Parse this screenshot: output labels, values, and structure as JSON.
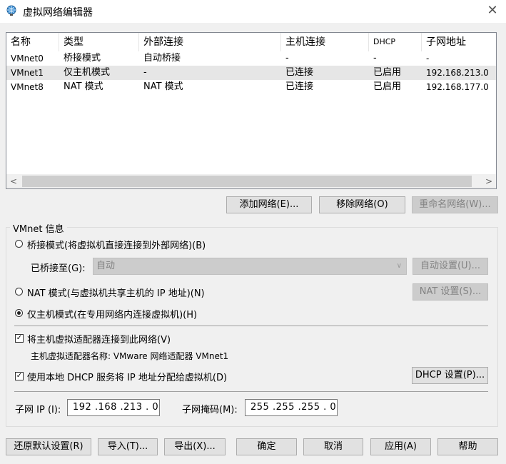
{
  "window": {
    "title": "虚拟网络编辑器",
    "close": "✕"
  },
  "table": {
    "headers": [
      "名称",
      "类型",
      "外部连接",
      "主机连接",
      "DHCP",
      "子网地址"
    ],
    "rows": [
      [
        "VMnet0",
        "桥接模式",
        "自动桥接",
        "-",
        "-",
        "-"
      ],
      [
        "VMnet1",
        "仅主机模式",
        "-",
        "已连接",
        "已启用",
        "192.168.213.0"
      ],
      [
        "VMnet8",
        "NAT 模式",
        "NAT 模式",
        "已连接",
        "已启用",
        "192.168.177.0"
      ]
    ],
    "scroll_left": "<",
    "scroll_right": ">"
  },
  "list_buttons": {
    "add": "添加网络(E)...",
    "remove": "移除网络(O)",
    "rename": "重命名网络(W)..."
  },
  "vmnet_info": {
    "label": "VMnet 信息",
    "bridged": "桥接模式(将虚拟机直接连接到外部网络)(B)",
    "bridged_to_label": "已桥接至(G):",
    "bridged_to_value": "自动",
    "auto_settings": "自动设置(U)...",
    "nat": "NAT 模式(与虚拟机共享主机的 IP 地址)(N)",
    "nat_settings": "NAT 设置(S)...",
    "host_only": "仅主机模式(在专用网络内连接虚拟机)(H)",
    "connect_adapter": "将主机虚拟适配器连接到此网络(V)",
    "adapter_name": "主机虚拟适配器名称: VMware 网络适配器 VMnet1",
    "use_dhcp": "使用本地 DHCP 服务将 IP 地址分配给虚拟机(D)",
    "dhcp_settings": "DHCP 设置(P)...",
    "subnet_ip_label": "子网 IP (I):",
    "subnet_ip": "192 .168 .213 .  0",
    "subnet_mask_label": "子网掩码(M):",
    "subnet_mask": "255 .255 .255 .  0",
    "selected_mode": "host_only"
  },
  "footer": {
    "restore": "还原默认设置(R)",
    "import": "导入(T)...",
    "export": "导出(X)...",
    "ok": "确定",
    "cancel": "取消",
    "apply": "应用(A)",
    "help": "帮助"
  }
}
